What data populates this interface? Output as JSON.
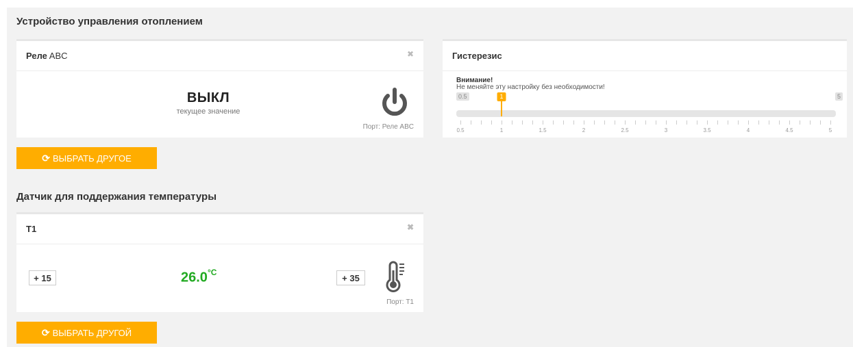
{
  "heating": {
    "section_title": "Устройство управления отоплением",
    "relay": {
      "title_bold": "Реле",
      "title_rest": " ABC",
      "value": "ВЫКЛ",
      "value_caption": "текущее значение",
      "port": "Порт: Реле ABC",
      "select_button": "ВЫБРАТЬ ДРУГОЕ"
    },
    "hysteresis": {
      "title": "Гистерезис",
      "warning_title": "Внимание!",
      "warning_text": "Не меняйте эту настройку без необходимости!",
      "min_badge": "0.5",
      "max_badge": "5",
      "value_badge": "1",
      "value": 1,
      "min": 0.5,
      "max": 5,
      "scale_labels": [
        "0.5",
        "1",
        "1.5",
        "2",
        "2.5",
        "3",
        "3.5",
        "4",
        "4.5",
        "5"
      ]
    }
  },
  "sensor": {
    "section_title": "Датчик для поддержания температуры",
    "name": "T1",
    "min_value": "+ 15",
    "current_value": "26.0",
    "unit": "°C",
    "max_value": "+ 35",
    "port": "Порт: T1",
    "select_button": "ВЫБРАТЬ ДРУГОЙ"
  },
  "colors": {
    "accent": "#ffad00",
    "temperature_ok": "#22aa22"
  }
}
